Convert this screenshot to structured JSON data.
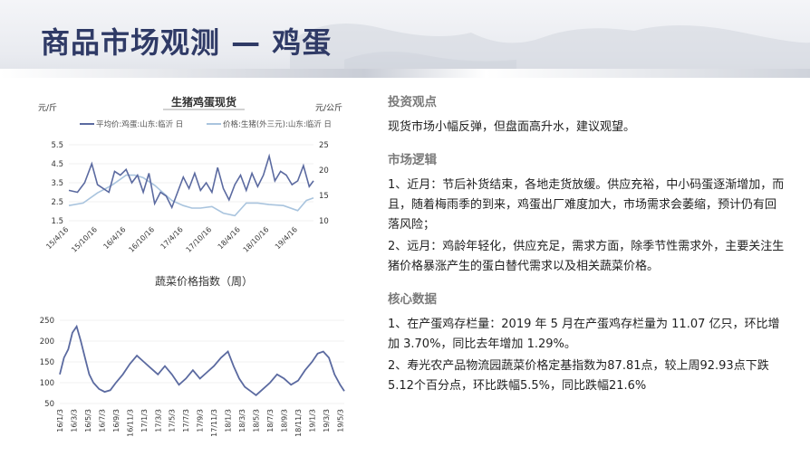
{
  "header": {
    "title": "商品市场观测 — 鸡蛋"
  },
  "chart_data": [
    {
      "type": "line",
      "title": "生猪鸡蛋现货",
      "ylabel_left": "元/斤",
      "ylabel_right": "元/公斤",
      "y_left_ticks": [
        "1.5",
        "2.5",
        "3.5",
        "4.5",
        "5.5"
      ],
      "y_left_range": [
        1.5,
        5.5
      ],
      "y_right_ticks": [
        "10",
        "15",
        "20",
        "25"
      ],
      "y_right_range": [
        10,
        25
      ],
      "x_ticks": [
        "15/4/16",
        "15/10/16",
        "16/4/16",
        "16/10/16",
        "17/4/16",
        "17/10/16",
        "18/4/16",
        "18/10/16",
        "19/4/16"
      ],
      "x_range": [
        0,
        8.55
      ],
      "series": [
        {
          "name": "平均价:鸡蛋:山东:临沂 日",
          "axis": "left",
          "color": "#5b6aa0",
          "x": [
            0,
            0.3,
            0.55,
            0.8,
            1.0,
            1.2,
            1.4,
            1.6,
            1.8,
            2.0,
            2.2,
            2.4,
            2.6,
            2.8,
            3.0,
            3.2,
            3.4,
            3.6,
            3.8,
            4.0,
            4.2,
            4.4,
            4.6,
            4.8,
            5.0,
            5.2,
            5.4,
            5.6,
            5.8,
            6.0,
            6.2,
            6.4,
            6.6,
            6.8,
            7.0,
            7.2,
            7.4,
            7.6,
            7.8,
            8.0,
            8.2,
            8.4,
            8.55
          ],
          "y": [
            3.1,
            3.0,
            3.5,
            4.5,
            3.4,
            3.2,
            3.0,
            4.1,
            3.9,
            4.2,
            3.5,
            3.9,
            3.0,
            4.0,
            2.4,
            3.0,
            2.8,
            2.2,
            3.0,
            3.8,
            3.2,
            4.0,
            3.1,
            3.5,
            3.0,
            4.3,
            3.2,
            2.6,
            3.4,
            3.9,
            3.1,
            4.0,
            3.3,
            3.9,
            4.9,
            3.6,
            4.1,
            3.9,
            3.4,
            3.6,
            4.4,
            3.3,
            3.6
          ]
        },
        {
          "name": "价格:生猪(外三元):山东:临沂 日",
          "axis": "right",
          "color": "#a9c4de",
          "x": [
            0,
            0.5,
            1.0,
            1.5,
            2.0,
            2.3,
            2.6,
            3.0,
            3.3,
            3.6,
            4.0,
            4.3,
            4.6,
            5.0,
            5.4,
            5.8,
            6.2,
            6.6,
            7.0,
            7.5,
            8.0,
            8.3,
            8.55
          ],
          "y": [
            13,
            13.5,
            15.5,
            17,
            19,
            19,
            18.5,
            17,
            15.5,
            14,
            13,
            12.5,
            12.5,
            12.8,
            11.5,
            11,
            13.5,
            13.5,
            13.2,
            13.0,
            12,
            14,
            14.5
          ]
        }
      ]
    },
    {
      "type": "line",
      "title": "蔬菜价格指数（周）",
      "y_ticks": [
        "50",
        "100",
        "150",
        "200",
        "250"
      ],
      "y_range": [
        50,
        250
      ],
      "x_ticks": [
        "16/1/3",
        "16/3/3",
        "16/5/3",
        "16/7/3",
        "16/9/3",
        "16/11/3",
        "17/1/3",
        "17/3/3",
        "17/5/3",
        "17/7/3",
        "17/9/3",
        "17/11/3",
        "18/1/3",
        "18/3/3",
        "18/5/3",
        "18/7/3",
        "18/9/3",
        "18/11/3",
        "19/1/3",
        "19/3/3",
        "19/5/3"
      ],
      "x_range": [
        0,
        20.3
      ],
      "series": [
        {
          "color": "#5b6aa0",
          "x": [
            0,
            0.3,
            0.6,
            0.9,
            1.2,
            1.5,
            1.8,
            2.1,
            2.4,
            2.8,
            3.2,
            3.6,
            4.0,
            4.5,
            5.0,
            5.5,
            6.0,
            6.5,
            7.0,
            7.5,
            8.0,
            8.5,
            9.0,
            9.5,
            10.0,
            10.5,
            11.0,
            11.5,
            12.0,
            12.4,
            12.8,
            13.2,
            13.6,
            14.0,
            14.5,
            15.0,
            15.5,
            16.0,
            16.5,
            17.0,
            17.5,
            18.0,
            18.4,
            18.8,
            19.2,
            19.6,
            20.0,
            20.3
          ],
          "y": [
            120,
            160,
            180,
            220,
            235,
            200,
            160,
            120,
            100,
            85,
            78,
            82,
            100,
            120,
            145,
            165,
            150,
            135,
            120,
            140,
            120,
            95,
            110,
            130,
            110,
            125,
            140,
            160,
            175,
            140,
            110,
            90,
            80,
            70,
            85,
            100,
            120,
            110,
            95,
            105,
            130,
            150,
            170,
            175,
            160,
            120,
            95,
            80
          ]
        }
      ]
    }
  ],
  "right_panel": {
    "investment": {
      "title": "投资观点",
      "text": "现货市场小幅反弹，但盘面高升水，建议观望。"
    },
    "logic": {
      "title": "市场逻辑",
      "p1": "1、近月：节后补货结束，各地走货放缓。供应充裕，中小码蛋逐渐增加，而且，随着梅雨季的到来，鸡蛋出厂难度加大，市场需求会萎缩，预计仍有回落风险；",
      "p2": "2、远月：鸡龄年轻化，供应充足，需求方面，除季节性需求外，主要关注生猪价格暴涨产生的蛋白替代需求以及相关蔬菜价格。"
    },
    "core": {
      "title": "核心数据",
      "p1": "1、在产蛋鸡存栏量：2019 年 5 月在产蛋鸡存栏量为 11.07 亿只，环比增加 3.70%，同比去年增加 1.29%。",
      "p2": "2、寿光农产品物流园蔬菜价格定基指数为87.81点，较上周92.93点下跌5.12个百分点，环比跌幅5.5%，同比跌幅21.6%"
    }
  }
}
